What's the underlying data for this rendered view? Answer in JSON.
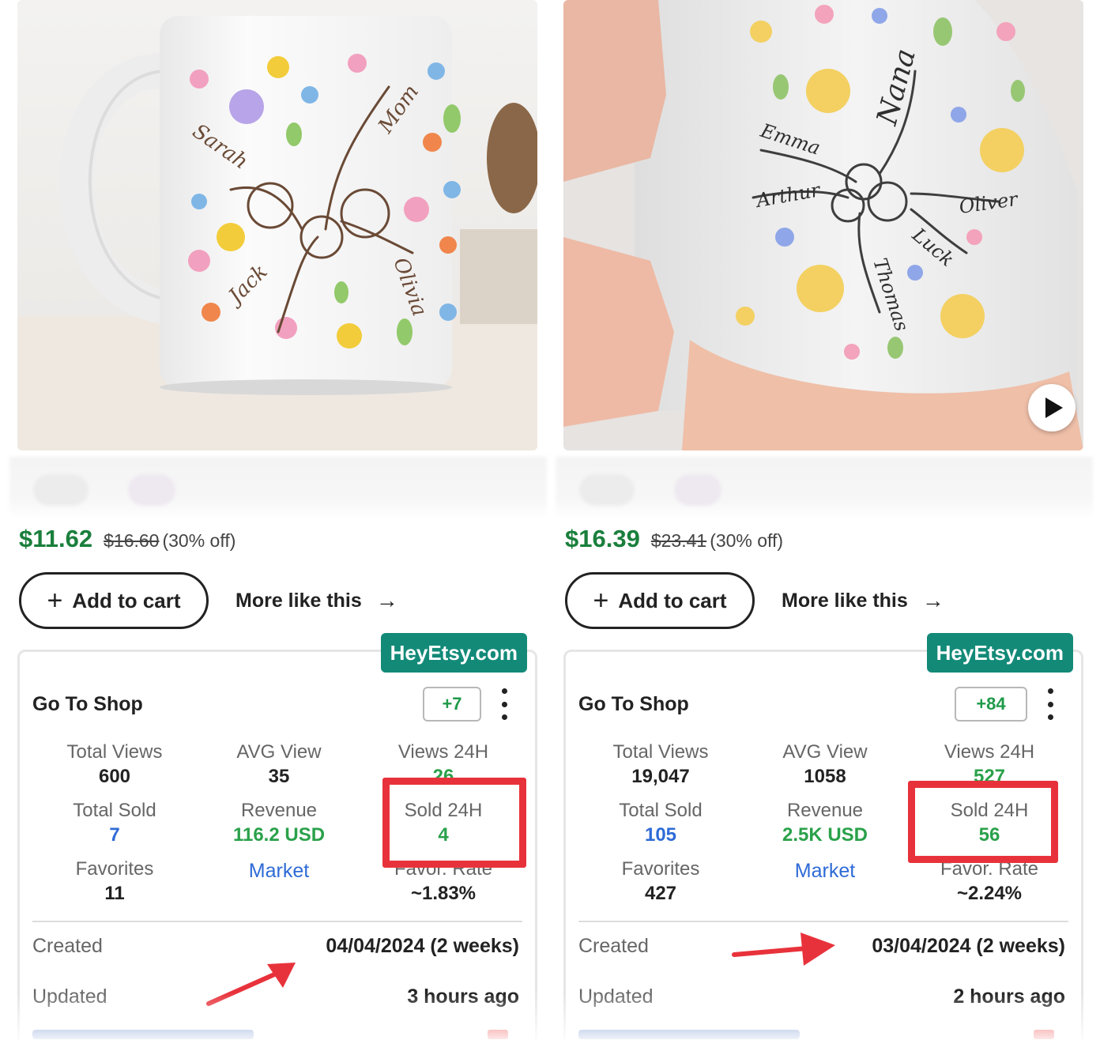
{
  "colors": {
    "price_green": "#1a7f3c",
    "badge_teal": "#138a78",
    "value_blue": "#2e6bd6",
    "value_green": "#2aa14a",
    "highlight_red": "#e8323b"
  },
  "products": [
    {
      "mug_names": [
        "Sarah",
        "Mom",
        "Jack",
        "Olivia"
      ],
      "price_now": "$11.62",
      "price_old": "$16.60",
      "discount": "(30% off)",
      "add_to_cart": "Add to cart",
      "more_like_this": "More like this",
      "brand_badge": "HeyEtsy.com",
      "shop_link": "Go To Shop",
      "count_badge": "+7",
      "stats": {
        "total_views": {
          "label": "Total Views",
          "value": "600"
        },
        "avg_view": {
          "label": "AVG View",
          "value": "35"
        },
        "views_24h": {
          "label": "Views 24H",
          "value": "26"
        },
        "total_sold": {
          "label": "Total Sold",
          "value": "7"
        },
        "revenue": {
          "label": "Revenue",
          "value": "116.2 USD"
        },
        "sold_24h": {
          "label": "Sold 24H",
          "value": "4"
        },
        "favorites": {
          "label": "Favorites",
          "value": "11"
        },
        "market": {
          "label": "Market"
        },
        "favor_rate": {
          "label": "Favor. Rate",
          "value": "~1.83%"
        }
      },
      "created_label": "Created",
      "created_value": "04/04/2024 (2 weeks)",
      "updated_label": "Updated",
      "updated_value": "3 hours ago"
    },
    {
      "mug_names": [
        "Nana",
        "Emma",
        "Arthur",
        "Oliver",
        "Luck",
        "Thomas"
      ],
      "price_now": "$16.39",
      "price_old": "$23.41",
      "discount": "(30% off)",
      "add_to_cart": "Add to cart",
      "more_like_this": "More like this",
      "brand_badge": "HeyEtsy.com",
      "shop_link": "Go To Shop",
      "count_badge": "+84",
      "stats": {
        "total_views": {
          "label": "Total Views",
          "value": "19,047"
        },
        "avg_view": {
          "label": "AVG View",
          "value": "1058"
        },
        "views_24h": {
          "label": "Views 24H",
          "value": "527"
        },
        "total_sold": {
          "label": "Total Sold",
          "value": "105"
        },
        "revenue": {
          "label": "Revenue",
          "value": "2.5K USD"
        },
        "sold_24h": {
          "label": "Sold 24H",
          "value": "56"
        },
        "favorites": {
          "label": "Favorites",
          "value": "427"
        },
        "market": {
          "label": "Market"
        },
        "favor_rate": {
          "label": "Favor. Rate",
          "value": "~2.24%"
        }
      },
      "created_label": "Created",
      "created_value": "03/04/2024 (2 weeks)",
      "updated_label": "Updated",
      "updated_value": "2 hours ago"
    }
  ]
}
